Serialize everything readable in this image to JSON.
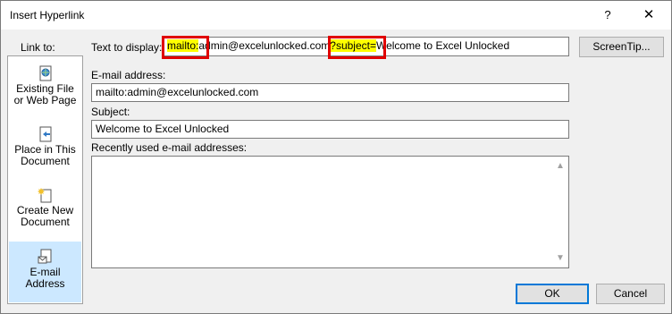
{
  "window": {
    "title": "Insert Hyperlink",
    "help_label": "?",
    "close_label": "✕"
  },
  "sidebar": {
    "title": "Link to:",
    "items": [
      {
        "line1": "Existing File",
        "line2": "or Web Page",
        "icon": "existing-file-icon"
      },
      {
        "line1": "Place in This",
        "line2": "Document",
        "icon": "place-in-document-icon"
      },
      {
        "line1": "Create New",
        "line2": "Document",
        "icon": "create-new-document-icon"
      },
      {
        "line1": "E-mail",
        "line2": "Address",
        "icon": "email-address-icon"
      }
    ]
  },
  "text_to_display": {
    "label": "Text to display:",
    "parts": [
      "mailto:",
      "admin@excelunlocked.com",
      "?subject=",
      "Welcome to Excel Unlocked"
    ]
  },
  "screentip_button": "ScreenTip...",
  "email_address": {
    "label": "E-mail address:",
    "value": "mailto:admin@excelunlocked.com"
  },
  "subject": {
    "label": "Subject:",
    "value": "Welcome to Excel Unlocked"
  },
  "recent_emails": {
    "label": "Recently used e-mail addresses:",
    "items": []
  },
  "buttons": {
    "ok": "OK",
    "cancel": "Cancel"
  },
  "colors": {
    "highlight": "#ffff00",
    "annotation_box": "#e00000",
    "selected_nav": "#cce8ff",
    "dialog_bg": "#f0f0f0"
  }
}
